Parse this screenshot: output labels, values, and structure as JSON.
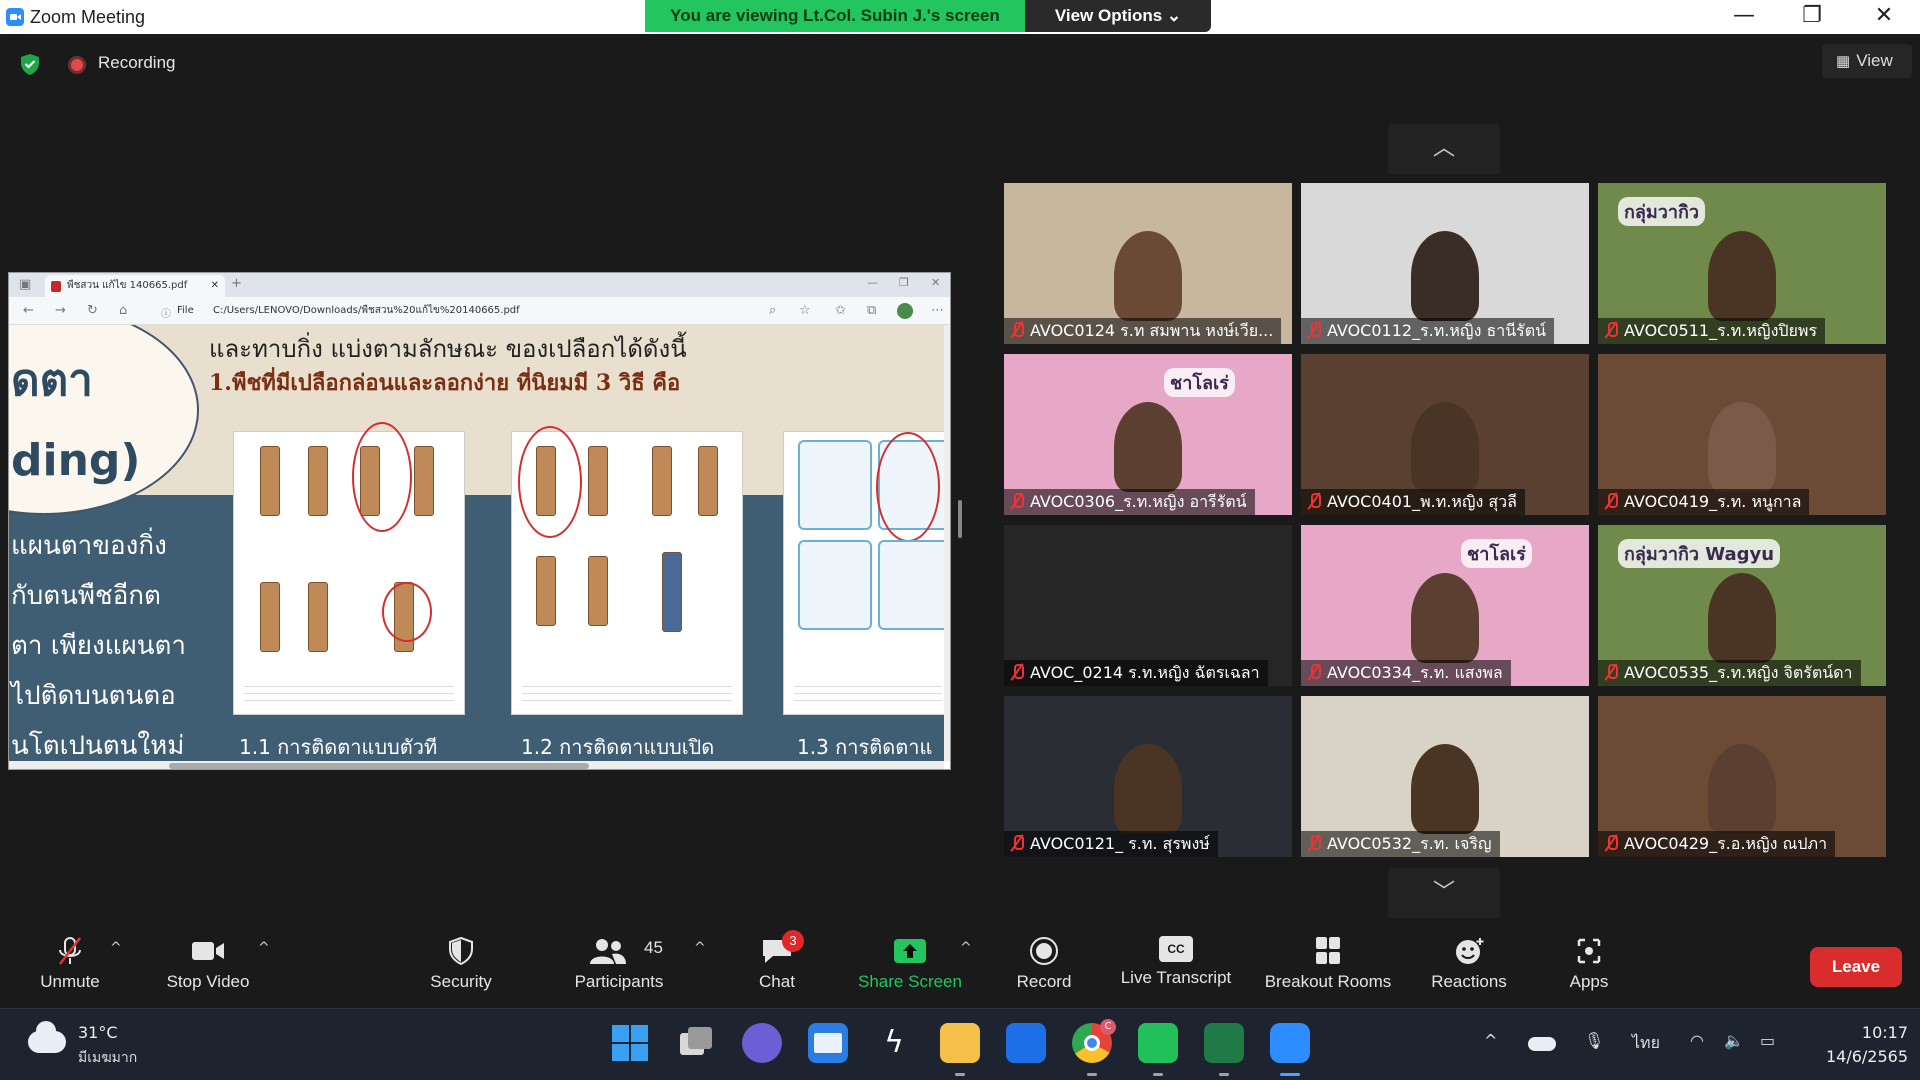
{
  "window": {
    "title": "Zoom Meeting",
    "viewing_banner": "You are viewing Lt.Col. Subin J.'s screen",
    "view_options": "View Options ⌄",
    "minimize": "—",
    "restore": "❐",
    "close": "✕"
  },
  "status": {
    "recording": "Recording",
    "view_label": "View",
    "gallery_up": "︿",
    "gallery_down": "﹀"
  },
  "shared_screen": {
    "tab_title": "พืชสวน แก้ไข 140665.pdf",
    "tab_close": "✕",
    "new_tab": "+",
    "file_label": "File",
    "address": "C:/Users/LENOVO/Downloads/พืชสวน%20แก้ไข%20140665.pdf",
    "heading1": "และทาบกิ่ง แบ่งตามลักษณะ ของเปลือกได้ดังนี้",
    "heading2": "1.พืชที่มีเปลือกล่อนและลอกง่าย   ที่นิยมมี 3 วิธี คือ",
    "big1": "ดตา",
    "big2": "ding)",
    "left_lines": [
      "แผนตาของกิ่ง",
      "กับตนพืชอีกต",
      "ตา เพียงแผนตา",
      "ไปติดบนตนตอ",
      "นโตเปนตนใหม่"
    ],
    "captions": [
      "1.1 การติดตาแบบตัวที",
      "1.2 การติดตาแบบเปิด",
      "1.3 การติดตาแ"
    ]
  },
  "participants": [
    {
      "name": "AVOC0124 ร.ท สมพาน หงษ์เวีย...",
      "bg": "#c8b79f",
      "skin": "#6b4a35",
      "badge": ""
    },
    {
      "name": "AVOC0112_ร.ท.หญิง ธานีรัตน์",
      "bg": "#d9d9d9",
      "skin": "#3a2c26",
      "badge": ""
    },
    {
      "name": "AVOC0511_ร.ท.หญิงปิยพร",
      "bg": "#6f8a4a",
      "skin": "#4a3424",
      "badge": "กลุ่มวากิว"
    },
    {
      "name": "AVOC0306_ร.ท.หญิง อารีรัตน์",
      "bg": "#e7a7c6",
      "skin": "#5b3f30",
      "badge": "ชาโลเร่"
    },
    {
      "name": "AVOC0401_พ.ท.หญิง สุวลี",
      "bg": "#5a4030",
      "skin": "#4a3426",
      "badge": ""
    },
    {
      "name": "AVOC0419_ร.ท. หนูกาล",
      "bg": "#6b4a36",
      "skin": "#7a5a48",
      "badge": ""
    },
    {
      "name": "AVOC_0214 ร.ท.หญิง ฉัตรเฉลา",
      "bg": "#262626",
      "skin": "",
      "badge": ""
    },
    {
      "name": "AVOC0334_ร.ท. แสงพล",
      "bg": "#e7a7c6",
      "skin": "#5b3f30",
      "badge": "ชาโลเร่"
    },
    {
      "name": "AVOC0535_ร.ท.หญิง จิตรัตน์ดา",
      "bg": "#6f8a4a",
      "skin": "#4a3424",
      "badge": "กลุ่มวากิว Wagyu"
    },
    {
      "name": "AVOC0121_ ร.ท. สุรพงษ์",
      "bg": "#2b2d35",
      "skin": "#4a3424",
      "badge": ""
    },
    {
      "name": "AVOC0532_ร.ท. เจริญ",
      "bg": "#d9d2c6",
      "skin": "#4a3424",
      "badge": ""
    },
    {
      "name": "AVOC0429_ร.อ.หญิง ณปภา",
      "bg": "#6b4a36",
      "skin": "#5b3f30",
      "badge": ""
    }
  ],
  "toolbar": {
    "unmute": "Unmute",
    "stop_video": "Stop Video",
    "security": "Security",
    "participants": "Participants",
    "participants_count": "45",
    "chat": "Chat",
    "chat_badge": "3",
    "share_screen": "Share Screen",
    "record": "Record",
    "live_transcript": "Live Transcript",
    "breakout_rooms": "Breakout Rooms",
    "reactions": "Reactions",
    "apps": "Apps",
    "leave": "Leave",
    "caret": "^",
    "cc": "CC"
  },
  "taskbar": {
    "temperature": "31°C",
    "weather": "มีเมฆมาก",
    "language": "ไทย",
    "time": "10:17",
    "date": "14/6/2565",
    "chrome_badge": "C",
    "tray_up": "^"
  },
  "colors": {
    "accent_green": "#22c55e",
    "leave_red": "#d92d2d",
    "mic_off_red": "#e33333"
  }
}
